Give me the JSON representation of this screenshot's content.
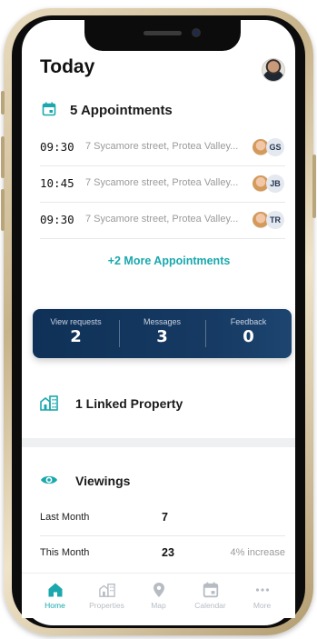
{
  "header": {
    "title": "Today"
  },
  "appointments": {
    "heading": "5 Appointments",
    "items": [
      {
        "time": "09:30",
        "address": "7 Sycamore street, Protea Valley...",
        "agent_initials": "GS"
      },
      {
        "time": "10:45",
        "address": "7 Sycamore street, Protea Valley...",
        "agent_initials": "JB"
      },
      {
        "time": "09:30",
        "address": "7 Sycamore street, Protea Valley...",
        "agent_initials": "TR"
      }
    ],
    "more_link": "+2 More Appointments"
  },
  "stats": [
    {
      "label": "View requests",
      "value": "2"
    },
    {
      "label": "Messages",
      "value": "3"
    },
    {
      "label": "Feedback",
      "value": "0"
    }
  ],
  "linked_property": {
    "heading": "1 Linked Property"
  },
  "viewings": {
    "heading": "Viewings",
    "rows": [
      {
        "label": "Last Month",
        "value": "7",
        "note": ""
      },
      {
        "label": "This Month",
        "value": "23",
        "note": "4% increase"
      }
    ]
  },
  "nav": [
    {
      "label": "Home",
      "icon": "home-icon",
      "active": true
    },
    {
      "label": "Properties",
      "icon": "buildings-icon",
      "active": false
    },
    {
      "label": "Map",
      "icon": "map-pin-icon",
      "active": false
    },
    {
      "label": "Calendar",
      "icon": "calendar-icon",
      "active": false
    },
    {
      "label": "More",
      "icon": "more-dots-icon",
      "active": false
    }
  ],
  "colors": {
    "accent": "#1aa8ae",
    "card": "#0f3157"
  }
}
